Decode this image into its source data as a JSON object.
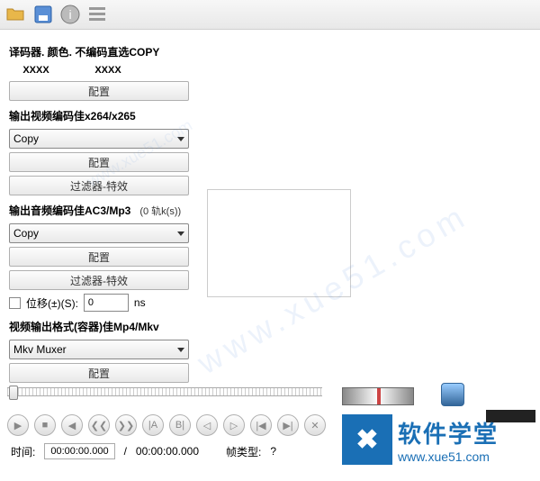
{
  "toolbar_icons": [
    "open-folder",
    "disk",
    "info",
    "properties"
  ],
  "decoder": {
    "title": "译码器. 颜色. 不编码直选COPY",
    "col1": "XXXX",
    "col2": "XXXX",
    "configure": "配置"
  },
  "video": {
    "title": "输出视频编码佳x264/x265",
    "selected": "Copy",
    "configure": "配置",
    "filters": "过滤器-特效"
  },
  "audio": {
    "title": "输出音频编码佳AC3/Mp3",
    "tracks": "(0 轨k(s))",
    "selected": "Copy",
    "configure": "配置",
    "filters": "过滤器-特效",
    "offset_label": "位移(±)(S):",
    "offset_value": "0",
    "offset_unit": "ns"
  },
  "output": {
    "title": "视频输出格式(容器)佳Mp4/Mkv",
    "selected": "Mkv Muxer",
    "configure": "配置"
  },
  "time": {
    "label": "时间:",
    "current": "00:00:00.000",
    "sep": "/",
    "total": "00:00:00.000",
    "frame_type_label": "帧类型:",
    "frame_type_val": "?"
  },
  "logo": {
    "cn": "软件学堂",
    "url": "www.xue51.com"
  },
  "watermark": "www.xue51.com"
}
